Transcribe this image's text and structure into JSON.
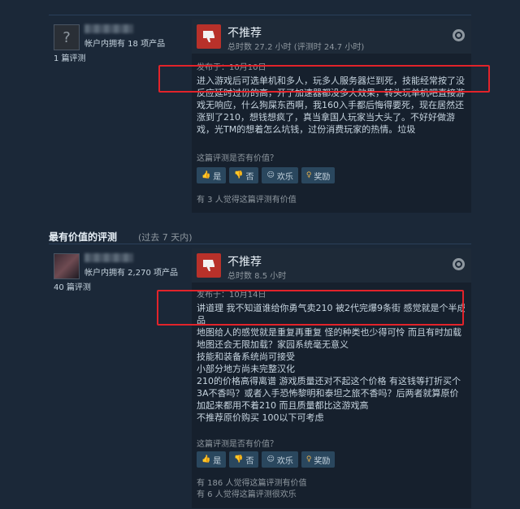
{
  "review1": {
    "owned": "帐户内拥有 18 项产品",
    "review_count": "1 篇评测",
    "verdict": "不推荐",
    "hours": "总时数 27.2 小时  (评测时 24.7 小时)",
    "posted": "发布于：10月10日",
    "body_lines": [
      "进入游戏后可选单机和多人，玩多人服务器烂到死，技能经常按了没",
      "反应延时过份的高，开了加速器都没多大效果，转头玩单机吧直接游",
      "戏无响应，什么狗屎东西啊，我160入手都后悔得要死，现在居然还",
      "涨到了210，想钱想疯了，真当拿国人玩家当大头了。不好好做游",
      "戏，光TM的想着怎么坑钱，过份消费玩家的热情。垃圾"
    ],
    "helpful_q": "这篇评测是否有价值？",
    "buttons": [
      "是",
      "否",
      "欢乐",
      "奖励"
    ],
    "footer": [
      "有 3 人觉得这篇评测有价值"
    ]
  },
  "section": {
    "title": "最有价值的评测",
    "subtitle": "(过去  7  天内)"
  },
  "review2": {
    "owned": "帐户内拥有 2,270 项产品",
    "review_count": "40 篇评测",
    "verdict": "不推荐",
    "hours": "总时数 8.5 小时",
    "posted": "发布于：10月14日",
    "body_lines": [
      "讲道理 我不知道谁给你勇气卖210 被2代完爆9条街 感觉就是个半成",
      "品",
      "地图给人的感觉就是重复再重复 怪的种类也少得可怜 而且有时加载",
      "地图还会无限加载？家园系统毫无意义",
      "技能和装备系统尚可接受",
      "小部分地方尚未完整汉化",
      "210的价格高得离谱 游戏质量还对不起这个价格 有这钱等打折买个",
      "3A不香吗？或者入手恐怖黎明和泰坦之旅不香吗？后两者就算原价",
      "加起来都用不着210 而且质量都比这游戏高",
      "不推荐原价购买 100以下可考虑"
    ],
    "helpful_q": "这篇评测是否有价值？",
    "buttons": [
      "是",
      "否",
      "欢乐",
      "奖励"
    ],
    "footer": [
      "有 186 人觉得这篇评测有价值",
      "有 6 人觉得这篇评测很欢乐"
    ]
  },
  "colors": {
    "background": "#1b2838",
    "thumb_red": "#b8312a",
    "highlight": "#e2232a"
  }
}
